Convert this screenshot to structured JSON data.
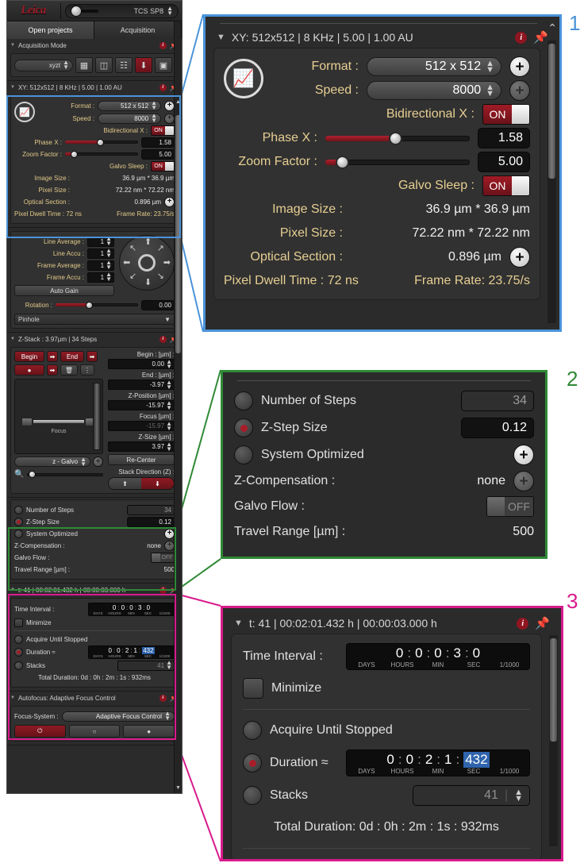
{
  "app": {
    "brand": "Leica",
    "model_selector": "TCS SP8",
    "tabs": [
      {
        "label": "Open projects",
        "active": true
      },
      {
        "label": "Acquisition",
        "active": false
      }
    ]
  },
  "acquisition_mode": {
    "title": "Acquisition Mode",
    "mode_value": "xyzt",
    "buttons": [
      "grid-config-icon",
      "tile-scan-icon",
      "grid-icon",
      "download-icon",
      "stack-icon"
    ]
  },
  "xy": {
    "header": "XY: 512x512 | 8 KHz | 5.00 | 1.00 AU",
    "format_label": "Format :",
    "format_value": "512 x 512",
    "speed_label": "Speed :",
    "speed_value": "8000",
    "bidirectional_label": "Bidirectional X :",
    "bidirectional_value": "ON",
    "phase_label": "Phase X :",
    "phase_value": "1.58",
    "phase_pct": 47,
    "zoom_label": "Zoom Factor :",
    "zoom_value": "5.00",
    "zoom_pct": 11,
    "galvo_sleep_label": "Galvo Sleep :",
    "galvo_sleep_value": "ON",
    "image_size_label": "Image Size :",
    "image_size_value": "36.9 µm * 36.9 µm",
    "pixel_size_label": "Pixel Size :",
    "pixel_size_value": "72.22 nm * 72.22 nm",
    "optical_section_label": "Optical Section :",
    "optical_section_value": "0.896 µm",
    "dwell_time": "Pixel Dwell Time : 72 ns",
    "frame_rate": "Frame Rate: 23.75/s"
  },
  "averaging": {
    "line_average_label": "Line Average :",
    "line_average_value": "1",
    "line_accu_label": "Line Accu :",
    "line_accu_value": "1",
    "frame_average_label": "Frame Average :",
    "frame_average_value": "1",
    "frame_accu_label": "Frame Accu :",
    "frame_accu_value": "1",
    "auto_gain_label": "Auto Gain",
    "rotation_label": "Rotation :",
    "rotation_value": "0.00",
    "rotation_pct": 40,
    "pinhole_label": "Pinhole"
  },
  "zstack": {
    "header": "Z-Stack : 3.97µm | 34 Steps",
    "begin_btn": "Begin",
    "end_btn": "End",
    "preview_label": "Focus",
    "device_value": "z - Galvo",
    "begin_label": "Begin : [µm] :",
    "begin_value": "0.00",
    "end_label": "End : [µm] :",
    "end_value": "-3.97",
    "zposition_label": "Z-Position [µm] :",
    "zposition_value": "-15.97",
    "focus_label": "Focus [µm] :",
    "focus_value": "-15.97",
    "zsize_label": "Z-Size [µm] :",
    "zsize_value": "3.97",
    "recenter_btn": "Re-Center",
    "stack_direction_label": "Stack Direction (Z) :"
  },
  "zsteps": {
    "number_of_steps_label": "Number of Steps",
    "number_of_steps_value": "34",
    "number_of_steps_selected": false,
    "z_step_size_label": "Z-Step Size",
    "z_step_size_value": "0.12",
    "z_step_size_selected": true,
    "system_optimized_label": "System Optimized",
    "system_optimized_selected": false,
    "z_compensation_label": "Z-Compensation :",
    "z_compensation_value": "none",
    "galvo_flow_label": "Galvo Flow :",
    "galvo_flow_value": "OFF",
    "travel_range_label": "Travel Range [µm] :",
    "travel_range_value": "500"
  },
  "timelapse": {
    "header": "t: 41 | 00:02:01.432 h | 00:00:03.000 h",
    "time_interval_label": "Time Interval :",
    "time_interval_digits": [
      "0",
      "0",
      "0",
      "3",
      "0"
    ],
    "time_units": [
      "DAYS",
      "HOURS",
      "MIN",
      "SEC",
      "1/1000"
    ],
    "minimize_label": "Minimize",
    "acquire_until_stopped_label": "Acquire Until Stopped",
    "acquire_until_stopped_selected": false,
    "duration_label": "Duration  ≈",
    "duration_selected": true,
    "duration_digits": [
      "0",
      "0",
      "2",
      "1",
      "432"
    ],
    "duration_highlight_index": 4,
    "stacks_label": "Stacks",
    "stacks_value": "41",
    "stacks_selected": false,
    "total_duration": "Total Duration:  0d : 0h : 2m : 1s : 932ms"
  },
  "autofocus": {
    "header": "Autofocus: Adaptive Focus Control",
    "focus_system_label": "Focus-System :",
    "focus_system_value": "Adaptive Focus Control"
  },
  "callouts": [
    {
      "number": "1",
      "color": "#4a93d9",
      "target": "xy"
    },
    {
      "number": "2",
      "color": "#2f8a36",
      "target": "zsteps"
    },
    {
      "number": "3",
      "color": "#d81b8c",
      "target": "timelapse"
    }
  ]
}
